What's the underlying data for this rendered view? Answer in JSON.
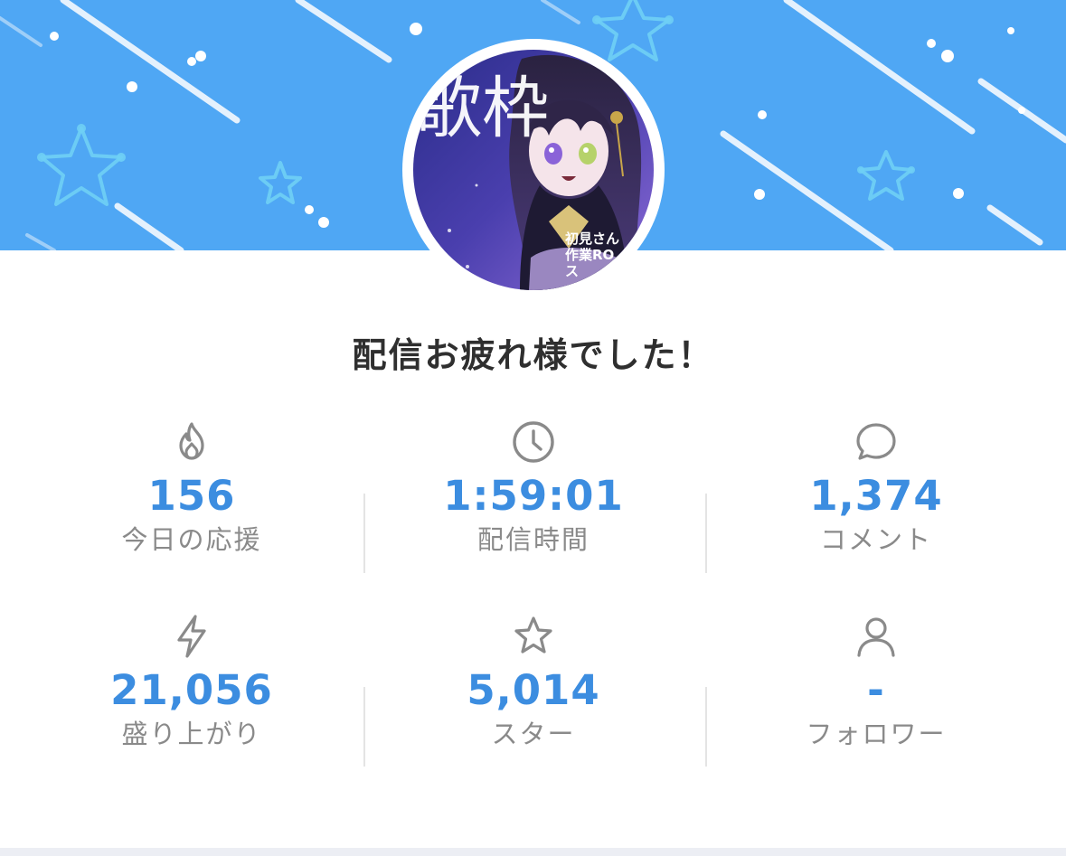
{
  "header": {
    "background_color": "#4fa7f4",
    "thumbnail": {
      "big_text": "歌枠",
      "small_lines": [
        "初見さん",
        "作業RO",
        "ス"
      ]
    }
  },
  "title": "配信お疲れ様でした！",
  "stats": [
    {
      "icon": "flame-icon",
      "value": "156",
      "label": "今日の応援"
    },
    {
      "icon": "clock-icon",
      "value": "1:59:01",
      "label": "配信時間"
    },
    {
      "icon": "comment-bubble-icon",
      "value": "1,374",
      "label": "コメント"
    },
    {
      "icon": "lightning-icon",
      "value": "21,056",
      "label": "盛り上がり"
    },
    {
      "icon": "star-icon",
      "value": "5,014",
      "label": "スター"
    },
    {
      "icon": "person-icon",
      "value": "-",
      "label": "フォロワー"
    }
  ],
  "colors": {
    "accent": "#3c8de0",
    "label": "#8a8a8a",
    "icon": "#8a8a8a",
    "title": "#2f2f2f"
  }
}
